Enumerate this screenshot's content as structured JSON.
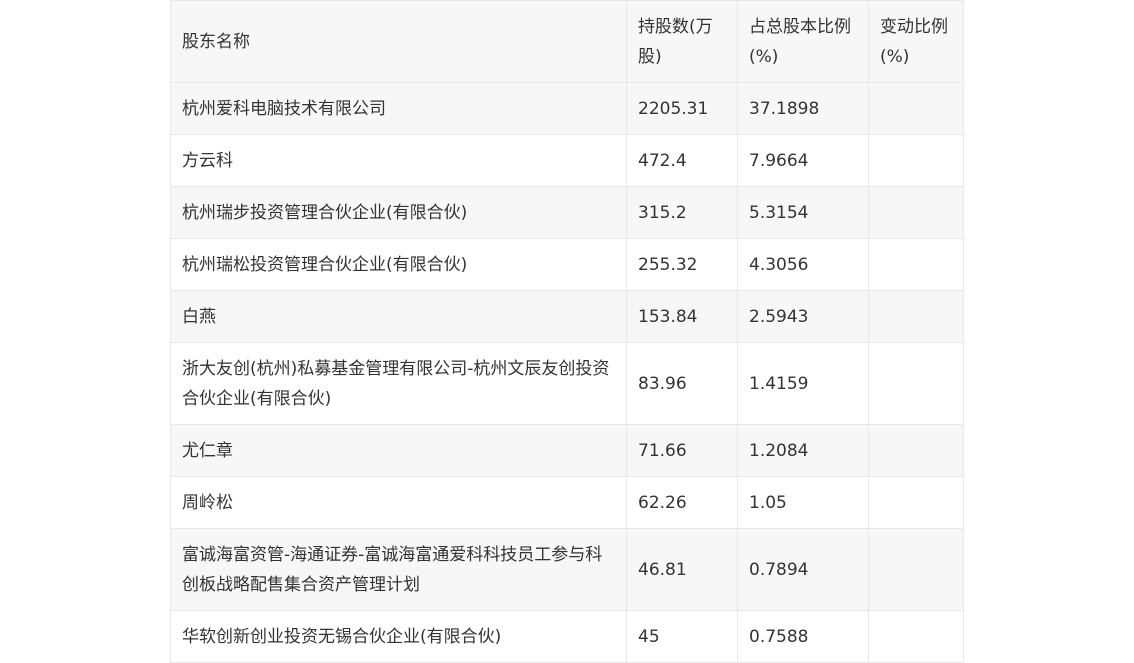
{
  "table": {
    "headers": [
      "股东名称",
      "持股数(万股)",
      "占总股本比例(%)",
      "变动比例(%)"
    ],
    "rows": [
      {
        "name": "杭州爱科电脑技术有限公司",
        "shares": "2205.31",
        "ratio": "37.1898",
        "change": ""
      },
      {
        "name": "方云科",
        "shares": "472.4",
        "ratio": "7.9664",
        "change": ""
      },
      {
        "name": "杭州瑞步投资管理合伙企业(有限合伙)",
        "shares": "315.2",
        "ratio": "5.3154",
        "change": ""
      },
      {
        "name": "杭州瑞松投资管理合伙企业(有限合伙)",
        "shares": "255.32",
        "ratio": "4.3056",
        "change": ""
      },
      {
        "name": "白燕",
        "shares": "153.84",
        "ratio": "2.5943",
        "change": ""
      },
      {
        "name": "浙大友创(杭州)私募基金管理有限公司-杭州文辰友创投资合伙企业(有限合伙)",
        "shares": "83.96",
        "ratio": "1.4159",
        "change": ""
      },
      {
        "name": "尤仁章",
        "shares": "71.66",
        "ratio": "1.2084",
        "change": ""
      },
      {
        "name": "周岭松",
        "shares": "62.26",
        "ratio": "1.05",
        "change": ""
      },
      {
        "name": "富诚海富资管-海通证券-富诚海富通爱科科技员工参与科创板战略配售集合资产管理计划",
        "shares": "46.81",
        "ratio": "0.7894",
        "change": ""
      },
      {
        "name": "华软创新创业投资无锡合伙企业(有限合伙)",
        "shares": "45",
        "ratio": "0.7588",
        "change": ""
      }
    ]
  }
}
